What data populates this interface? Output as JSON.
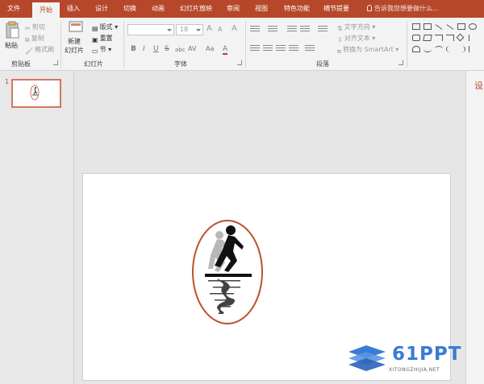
{
  "tabs": [
    {
      "label": "文件",
      "active": false
    },
    {
      "label": "开始",
      "active": true
    },
    {
      "label": "插入",
      "active": false
    },
    {
      "label": "设计",
      "active": false
    },
    {
      "label": "切换",
      "active": false
    },
    {
      "label": "动画",
      "active": false
    },
    {
      "label": "幻灯片放映",
      "active": false
    },
    {
      "label": "审阅",
      "active": false
    },
    {
      "label": "视图",
      "active": false
    },
    {
      "label": "特色功能",
      "active": false
    },
    {
      "label": "横节提要",
      "active": false
    }
  ],
  "tell_me": "告诉我您想要做什么...",
  "clipboard": {
    "paste": "粘贴",
    "cut": "剪切",
    "copy": "复制",
    "format_painter": "格式刷",
    "label": "剪贴板"
  },
  "slides_group": {
    "new_slide_line1": "新建",
    "new_slide_line2": "幻灯片",
    "layout": "版式",
    "reset": "重置",
    "section": "节",
    "label": "幻灯片"
  },
  "font_group": {
    "font_size": "18",
    "grow": "A",
    "shrink": "A",
    "clear": "A",
    "bold": "B",
    "italic": "I",
    "underline": "U",
    "strike": "S",
    "shadow": "abc",
    "spacing": "AV",
    "case": "Aa",
    "font_color": "A",
    "label": "字体"
  },
  "paragraph_group": {
    "text_direction": "文字方向",
    "align_text": "对齐文本",
    "smartart": "转换为 SmartArt",
    "label": "段落"
  },
  "thumbnails": {
    "slide_number": "1"
  },
  "right_pane": {
    "title": "设"
  },
  "watermark": {
    "main": "61PPT",
    "sub": "XITONGZHIJIA.NET"
  },
  "colors": {
    "accent": "#b7472a",
    "oval_border": "#c0502f"
  }
}
